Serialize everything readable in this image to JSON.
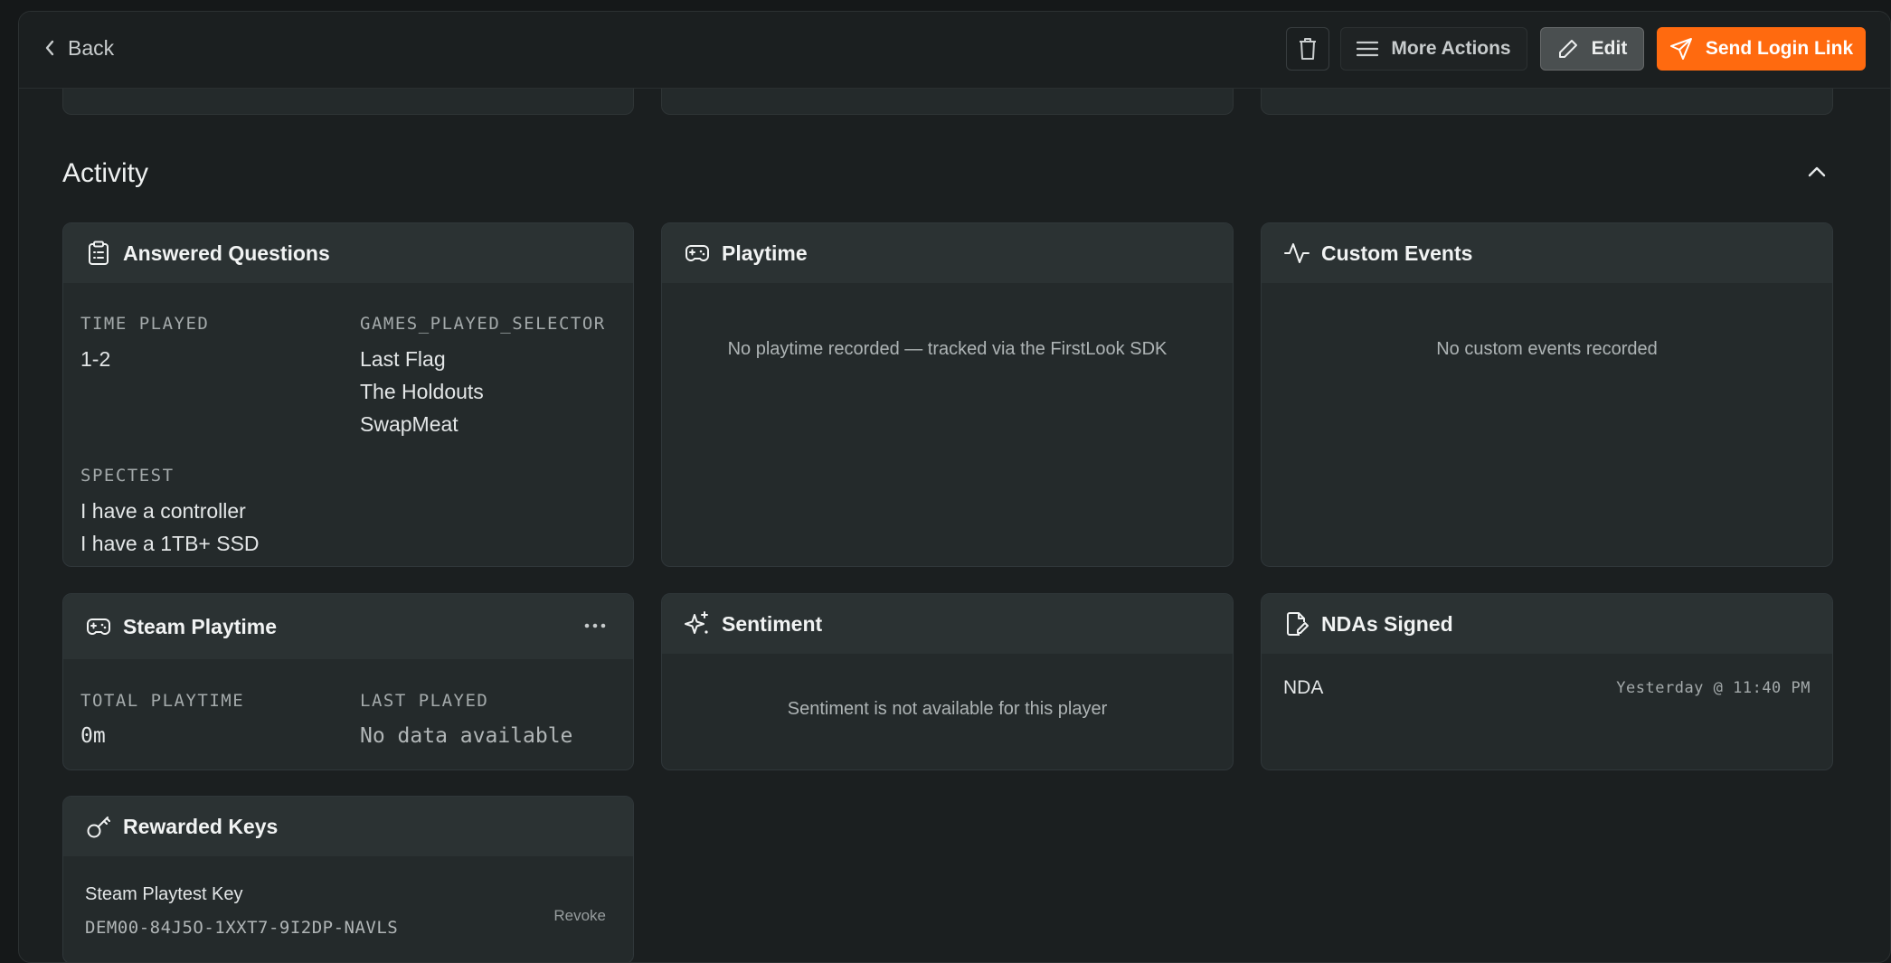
{
  "topbar": {
    "back_label": "Back",
    "more_actions_label": "More Actions",
    "edit_label": "Edit",
    "send_login_link_label": "Send Login Link"
  },
  "activity": {
    "title": "Activity"
  },
  "answered_questions": {
    "title": "Answered Questions",
    "fields": [
      {
        "label": "TIME PLAYED",
        "values": [
          "1-2"
        ]
      },
      {
        "label": "GAMES_PLAYED_SELECTOR",
        "values": [
          "Last Flag",
          "The Holdouts",
          "SwapMeat"
        ]
      },
      {
        "label": "SPECTEST",
        "values": [
          "I have a controller",
          "I have a 1TB+ SSD"
        ]
      }
    ]
  },
  "playtime": {
    "title": "Playtime",
    "empty_text": "No playtime recorded — tracked via the FirstLook SDK"
  },
  "custom_events": {
    "title": "Custom Events",
    "empty_text": "No custom events recorded"
  },
  "steam_playtime": {
    "title": "Steam Playtime",
    "total_label": "TOTAL PLAYTIME",
    "total_value": "0m",
    "last_label": "LAST PLAYED",
    "last_value": "No data available"
  },
  "sentiment": {
    "title": "Sentiment",
    "empty_text": "Sentiment is not available for this player"
  },
  "ndas": {
    "title": "NDAs Signed",
    "items": [
      {
        "name": "NDA",
        "date": "Yesterday @ 11:40 PM"
      }
    ]
  },
  "rewarded_keys": {
    "title": "Rewarded Keys",
    "items": [
      {
        "name": "Steam Playtest Key",
        "key": "DEM00-84J5O-1XXT7-9I2DP-NAVLS",
        "action": "Revoke"
      }
    ]
  },
  "colors": {
    "accent": "#ff6a0f",
    "background": "#1b1f20",
    "card": "#242a2b"
  }
}
